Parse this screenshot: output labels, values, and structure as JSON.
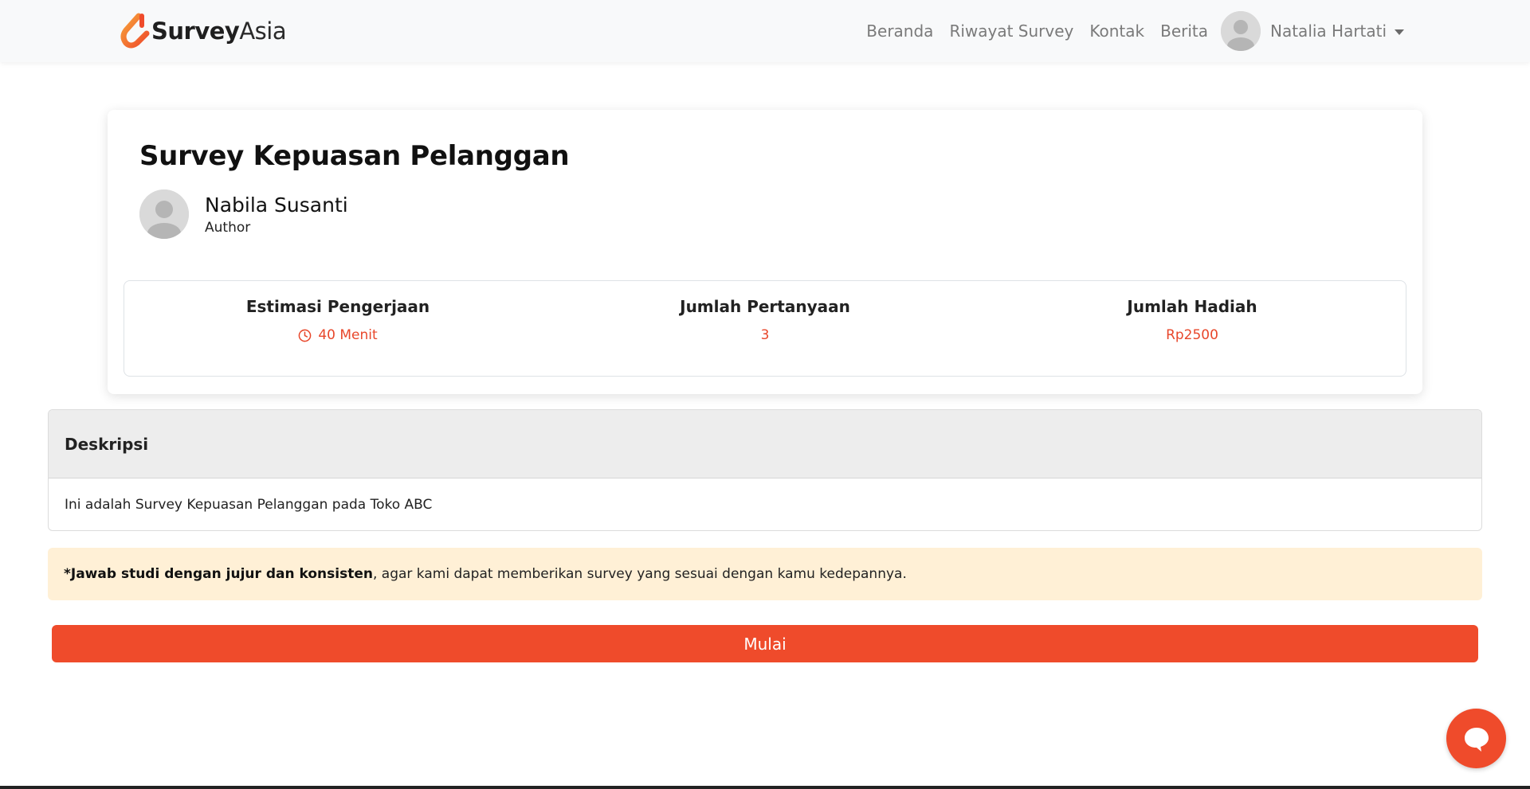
{
  "brand": {
    "name_bold": "Survey",
    "name_light": "Asia"
  },
  "nav": {
    "links": [
      "Beranda",
      "Riwayat Survey",
      "Kontak",
      "Berita"
    ],
    "user_name": "Natalia Hartati"
  },
  "survey": {
    "title": "Survey Kepuasan Pelanggan",
    "author_name": "Nabila Susanti",
    "author_role": "Author",
    "stats": [
      {
        "label": "Estimasi Pengerjaan",
        "value": "40 Menit",
        "icon": "clock-icon"
      },
      {
        "label": "Jumlah Pertanyaan",
        "value": "3"
      },
      {
        "label": "Jumlah Hadiah",
        "value": "Rp2500"
      }
    ]
  },
  "description": {
    "heading": "Deskripsi",
    "body": "Ini adalah Survey Kepuasan Pelanggan pada Toko ABC"
  },
  "notice": {
    "bold": "*Jawab studi dengan jujur dan konsisten",
    "rest": ", agar kami dapat memberikan survey yang sesuai dengan kamu kedepannya."
  },
  "actions": {
    "start_label": "Mulai"
  },
  "colors": {
    "accent": "#ef4b2b",
    "notice_bg": "#fff0d6",
    "navbar_bg": "#f8f9fa"
  }
}
